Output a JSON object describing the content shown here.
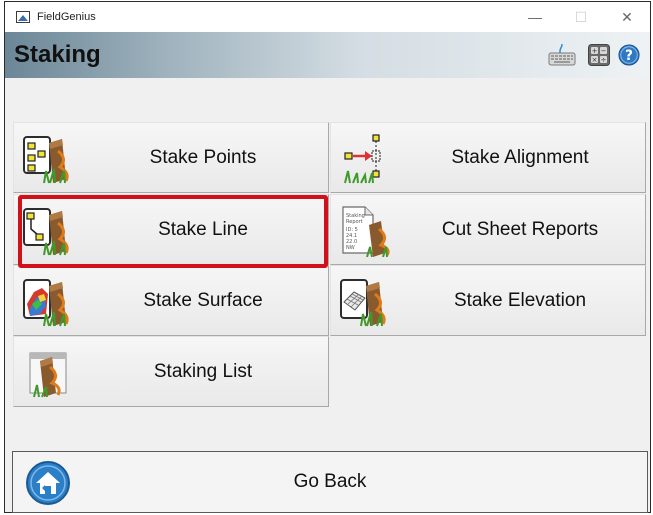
{
  "window": {
    "app_title": "FieldGenius",
    "minimize": "—",
    "maximize": "☐",
    "close": "✕"
  },
  "header": {
    "title": "Staking"
  },
  "tiles": [
    {
      "label": "Stake Points",
      "icon": "stake-points-icon"
    },
    {
      "label": "Stake Alignment",
      "icon": "stake-alignment-icon"
    },
    {
      "label": "Stake Line",
      "icon": "stake-line-icon",
      "highlighted": true
    },
    {
      "label": "Cut Sheet Reports",
      "icon": "cut-sheet-reports-icon"
    },
    {
      "label": "Stake Surface",
      "icon": "stake-surface-icon"
    },
    {
      "label": "Stake Elevation",
      "icon": "stake-elevation-icon"
    },
    {
      "label": "Staking List",
      "icon": "staking-list-icon"
    }
  ],
  "footer": {
    "go_back_label": "Go Back"
  },
  "colors": {
    "highlight": "#d0111b",
    "stake_orange": "#e07b1a",
    "header_gradient_start": "#6b8797"
  }
}
